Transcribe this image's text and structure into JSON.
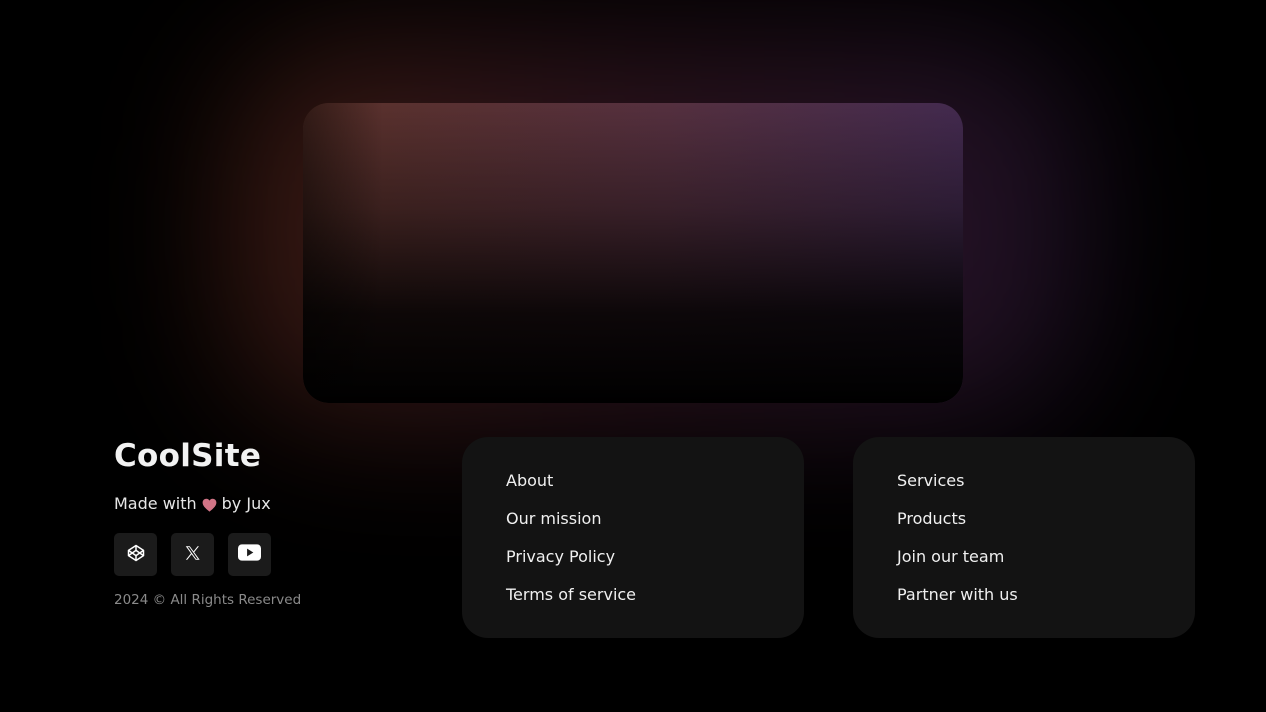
{
  "brand": {
    "title": "CoolSite",
    "made_with_prefix": "Made with",
    "made_with_suffix": "by Jux",
    "heart_icon": "heart-icon",
    "heart_color": "#d27486",
    "copyright": "2024 © All Rights Reserved"
  },
  "social": [
    {
      "name": "codepen",
      "icon": "codepen-icon"
    },
    {
      "name": "x",
      "icon": "x-icon"
    },
    {
      "name": "youtube",
      "icon": "youtube-icon"
    }
  ],
  "links_left": [
    "About",
    "Our mission",
    "Privacy Policy",
    "Terms of service"
  ],
  "links_right": [
    "Services",
    "Products",
    "Join our team",
    "Partner with us"
  ],
  "colors": {
    "background": "#000000",
    "panel": "#131313",
    "social_button": "#1b1b1b",
    "card_gradient_start": "#5b3129",
    "card_gradient_end": "#432a4f"
  }
}
